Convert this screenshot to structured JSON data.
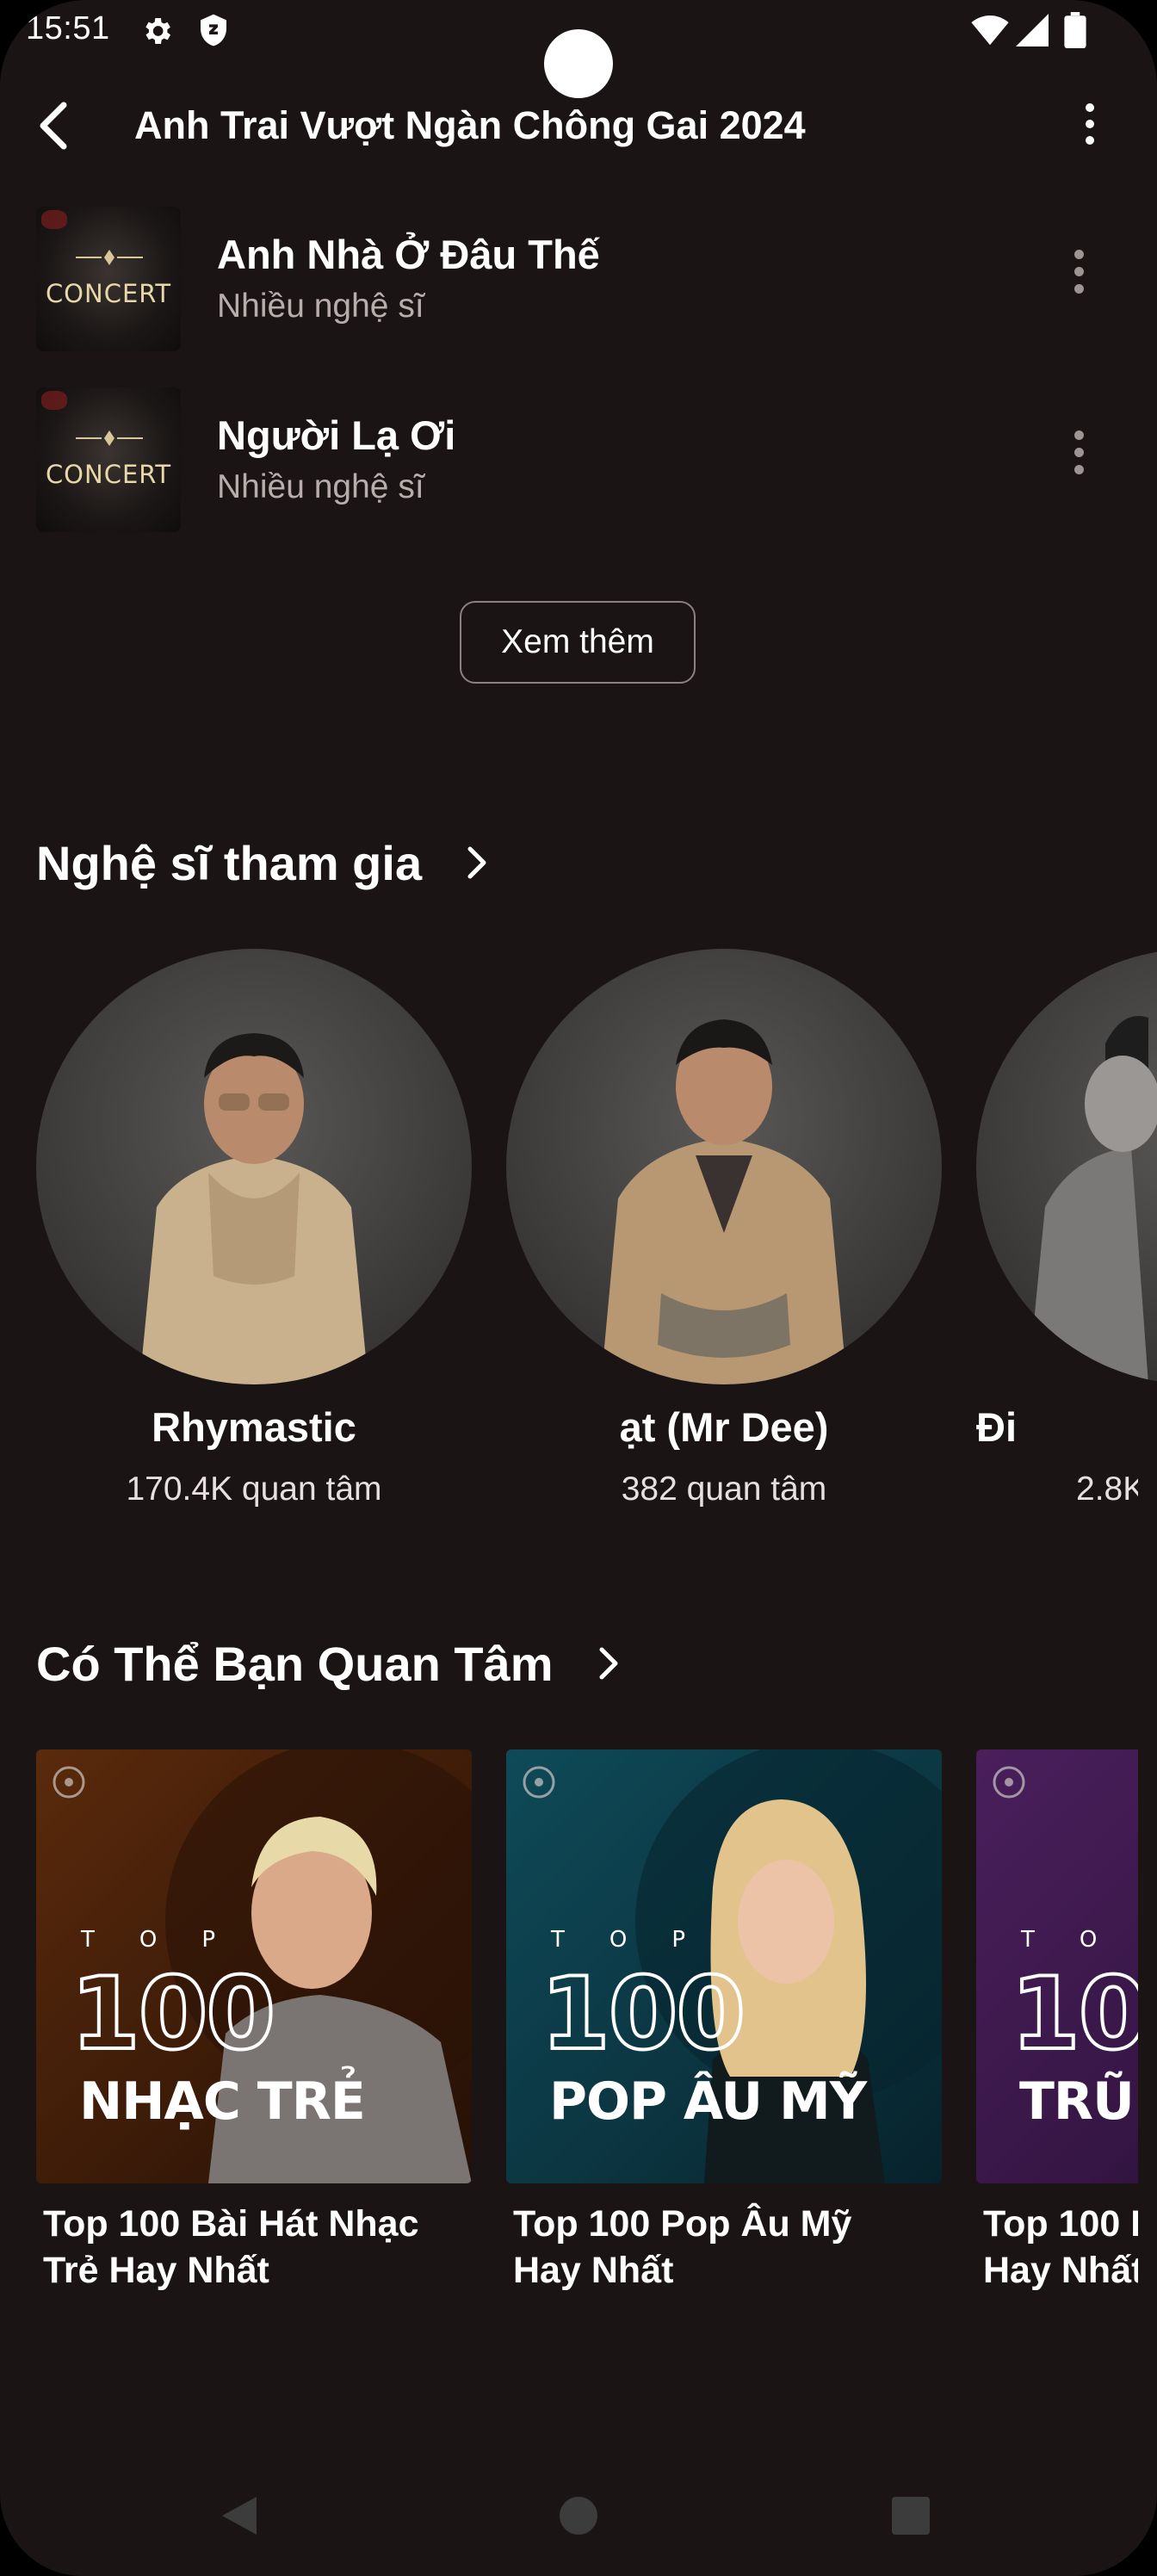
{
  "status_bar": {
    "time": "15:51"
  },
  "header": {
    "title": "Anh Trai Vượt Ngàn Chông Gai 2024"
  },
  "songs": [
    {
      "title": "Anh Nhà Ở Đâu Thế",
      "artist": "Nhiều nghệ sĩ",
      "cover_label": "CONCERT"
    },
    {
      "title": "Người Lạ Ơi",
      "artist": "Nhiều nghệ sĩ",
      "cover_label": "CONCERT"
    }
  ],
  "see_more_label": "Xem thêm",
  "artists_section": {
    "title": "Nghệ sĩ tham gia",
    "items": [
      {
        "name": "Rhymastic",
        "followers": "170.4K quan tâm"
      },
      {
        "name": "ạt (Mr Dee)",
        "followers": "382 quan tâm"
      },
      {
        "name": "Đi",
        "followers": "2.8K"
      }
    ]
  },
  "suggestions_section": {
    "title": "Có Thể Bạn Quan Tâm",
    "items": [
      {
        "title": "Top 100 Bài Hát Nhạc Trẻ Hay Nhất",
        "title_line1": "Top 100 Bài Hát Nhạc",
        "title_line2": "Trẻ Hay Nhất",
        "cover_top": "TOP",
        "cover_number": "100",
        "cover_genre": "NHẠC TRẺ",
        "cover_color": "#5a2a0c"
      },
      {
        "title": "Top 100 Pop Âu Mỹ Hay Nhất",
        "title_line1": "Top 100 Pop Âu Mỹ",
        "title_line2": "Hay Nhất",
        "cover_top": "TOP",
        "cover_number": "100",
        "cover_genre": "POP ÂU MỸ",
        "cover_color": "#0f4a58"
      },
      {
        "title": "Top 100 Hay Nhất",
        "title_line1": "Top 100 I",
        "title_line2": "Hay Nhất",
        "cover_top": "TO",
        "cover_number": "10",
        "cover_genre": "TRŨ",
        "cover_color": "#4a1f5c"
      }
    ]
  },
  "icons": {
    "status": [
      "gear-icon",
      "shield-icon",
      "wifi-icon",
      "signal-icon",
      "battery-icon"
    ],
    "header": [
      "back-arrow-icon",
      "more-vert-icon"
    ],
    "nav": [
      "nav-back-icon",
      "nav-home-icon",
      "nav-recents-icon"
    ]
  }
}
